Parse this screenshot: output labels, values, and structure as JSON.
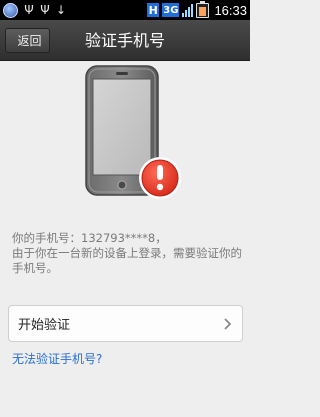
{
  "status_bar": {
    "time": "16:33",
    "network_badge": "H",
    "network_type": "3G",
    "usb_symbol": "Ψ",
    "download_symbol": "↓"
  },
  "title_bar": {
    "back_label": "返回",
    "title": "验证手机号"
  },
  "message": {
    "line1": "你的手机号：132793****8，",
    "line2": "由于你在一台新的设备上登录，需要验证你的手机号。"
  },
  "start_button": {
    "label": "开始验证"
  },
  "help_link": {
    "label": "无法验证手机号?"
  },
  "colors": {
    "accent_link": "#2b6fd0",
    "warning_red": "#e43a2a",
    "background": "#eeeeee"
  }
}
